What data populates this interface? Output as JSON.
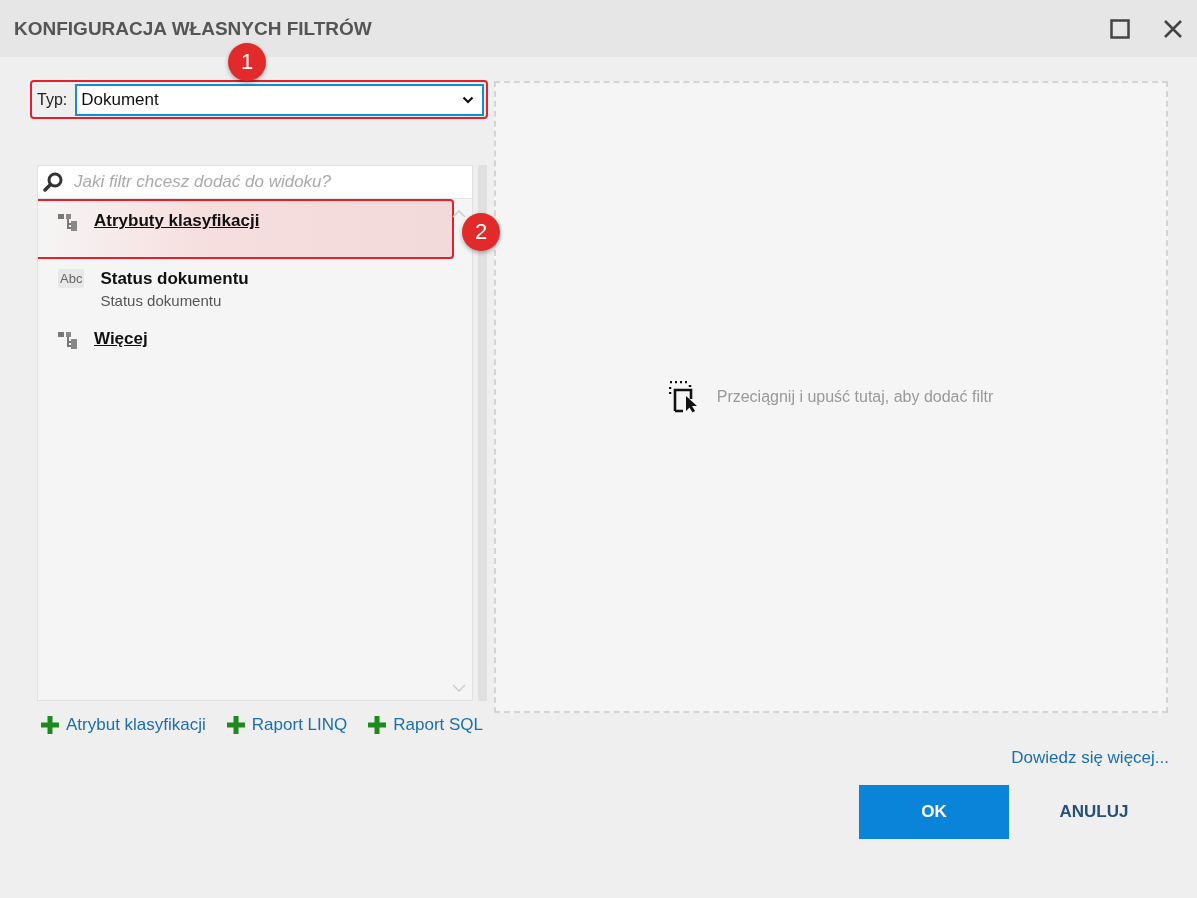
{
  "window": {
    "title": "KONFIGURACJA WŁASNYCH FILTRÓW"
  },
  "type_field": {
    "label": "Typ:",
    "value": "Dokument",
    "callout": "1"
  },
  "search": {
    "placeholder": "Jaki filtr chcesz dodać do widoku?"
  },
  "filters": [
    {
      "kind": "group",
      "title": "Atrybuty klasyfikacji",
      "callout": "2"
    },
    {
      "kind": "text",
      "icon_text": "Abc",
      "title": "Status dokumentu",
      "subtitle": "Status dokumentu"
    },
    {
      "kind": "group",
      "title": "Więcej"
    }
  ],
  "add_links": [
    "Atrybut klasyfikacji",
    "Raport LINQ",
    "Raport SQL"
  ],
  "drop_zone": {
    "hint": "Przeciągnij i upuść tutaj, aby dodać filtr"
  },
  "help_link": "Dowiedz się więcej...",
  "buttons": [
    {
      "label": "OK",
      "kind": "primary"
    },
    {
      "label": "ANULUJ",
      "kind": "flat"
    }
  ]
}
